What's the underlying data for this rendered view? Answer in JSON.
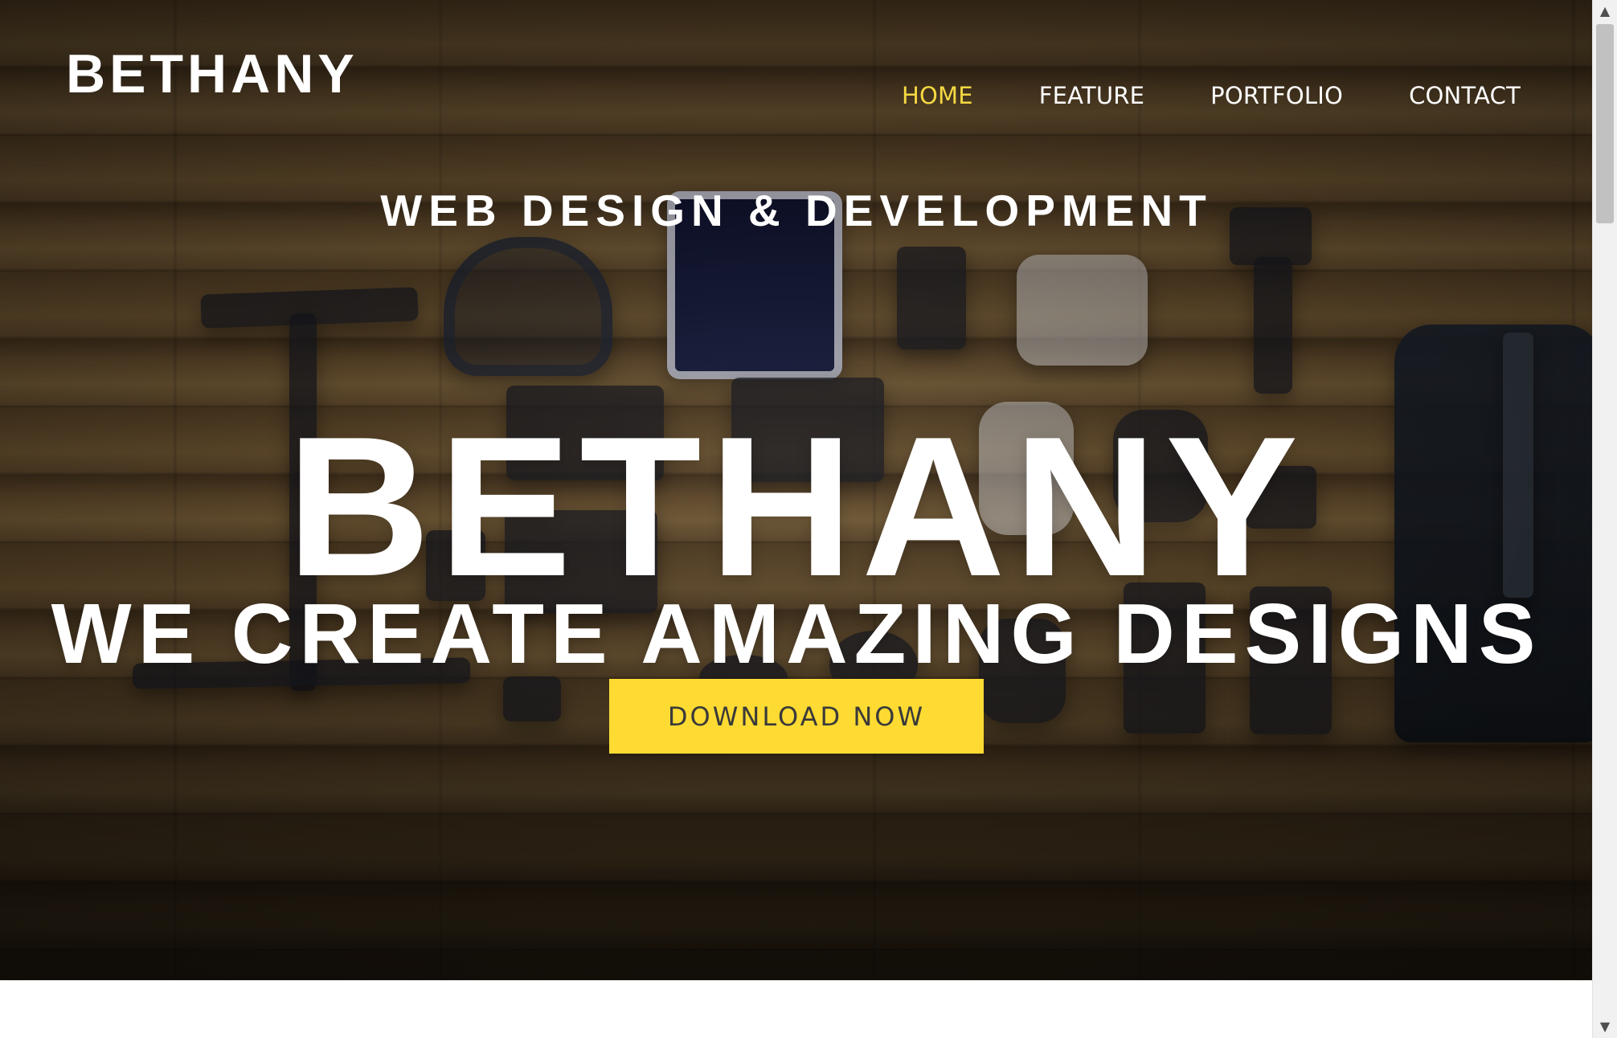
{
  "brand": {
    "logo_text": "BETHANY"
  },
  "navigation": {
    "items": [
      {
        "label": "HOME",
        "active": true
      },
      {
        "label": "FEATURE",
        "active": false
      },
      {
        "label": "PORTFOLIO",
        "active": false
      },
      {
        "label": "CONTACT",
        "active": false
      }
    ]
  },
  "hero": {
    "eyebrow": "WEB DESIGN & DEVELOPMENT",
    "headline": "BETHANY",
    "subheadline": "WE CREATE AMAZING DESIGNS",
    "cta_label": "DOWNLOAD NOW"
  },
  "scrollbar": {
    "up_glyph": "▲",
    "down_glyph": "▼"
  },
  "colors": {
    "accent_yellow": "#fddb32",
    "nav_active": "#f5d842",
    "text_white": "#ffffff",
    "button_text": "#3a3a3a",
    "page_background": "#ffffff"
  }
}
